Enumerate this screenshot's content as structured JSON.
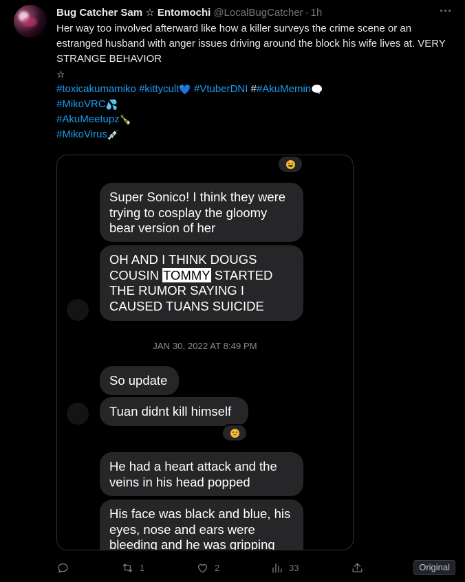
{
  "author": {
    "display_name": "Bug Catcher Sam ☆ Entomochi",
    "handle": "@LocalBugCatcher",
    "separator": "·",
    "time": "1h"
  },
  "tweet": {
    "body": "Her way too involved afterward like how a killer surveys the crime scene or an estranged husband with anger issues driving around the block his wife lives at. VERY STRANGE BEHAVIOR",
    "star": "☆",
    "hashtags": {
      "h1": "#toxicakumamiko",
      "h2": "#kittycult",
      "h3": "#VtuberDNI",
      "h4_prefix": "#",
      "h4": "#AkuMemin",
      "h5": "#MikoVRC",
      "h6": "#AkuMeetupz",
      "h7": "#MikoVirus"
    },
    "emoji_names": [
      "blue-heart",
      "speech-balloon",
      "sweat-droplets",
      "champagne",
      "syringe"
    ]
  },
  "screenshot": {
    "messages": [
      {
        "text": "Super Sonico! I think they were trying to cosplay the gloomy bear version of her"
      },
      {
        "before": "OH AND I THINK DOUGS COUSIN ",
        "highlight": "TOMMY",
        "after": " STARTED THE RUMOR SAYING I CAUSED TUANS SUICIDE"
      },
      {
        "text": "So update"
      },
      {
        "text": "Tuan didnt kill himself"
      },
      {
        "text": "He had a heart attack and the veins in his head popped"
      },
      {
        "text": "His face was black and blue, his  eyes, nose and ears were bleeding and he was gripping"
      }
    ],
    "timestamp": "JAN 30, 2022 AT 8:49 PM",
    "reactions": [
      "laughing-face",
      "sad-face"
    ]
  },
  "actions": {
    "reply_count": "",
    "retweet_count": "1",
    "like_count": "2",
    "views_count": "33",
    "original_label": "Original"
  },
  "colors": {
    "background": "#000000",
    "text": "#e7e9ea",
    "muted": "#71767b",
    "link": "#1d9bf0",
    "bubble": "#262628"
  }
}
